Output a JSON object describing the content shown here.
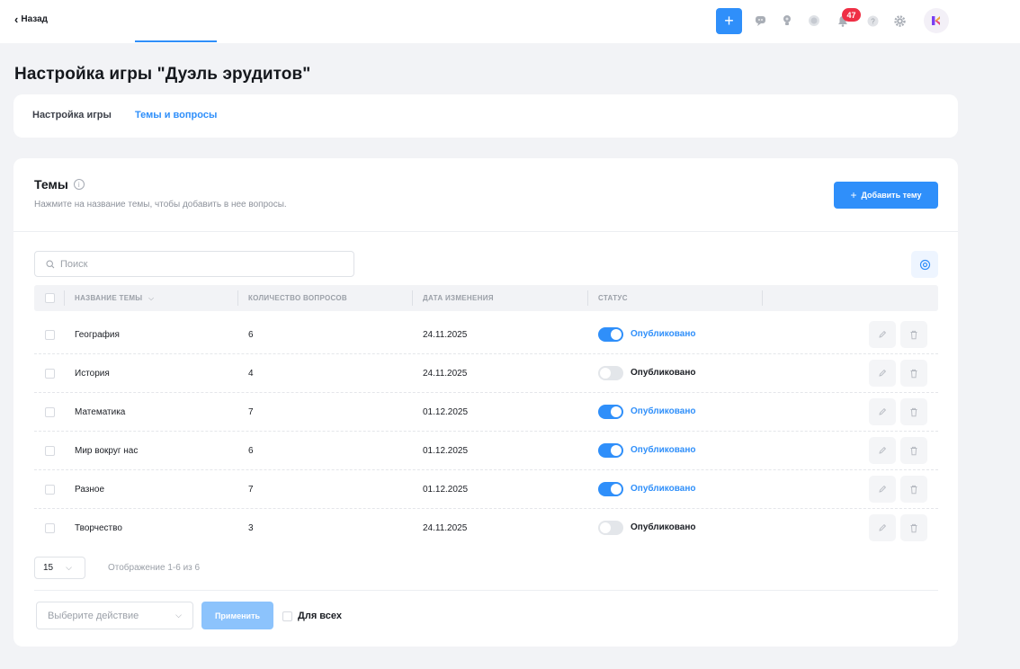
{
  "topbar": {
    "back_label": "Назад",
    "notifications_count": "47",
    "icons": [
      "plus-icon",
      "chat-icon",
      "lightbulb-icon",
      "search-icon",
      "bell-icon",
      "help-icon",
      "gear-icon",
      "logo-icon"
    ]
  },
  "page": {
    "title": "Настройка игры \"Дуэль эрудитов\""
  },
  "tabs": [
    {
      "label": "Настройка игры",
      "active": false
    },
    {
      "label": "Темы и вопросы",
      "active": true
    }
  ],
  "topics": {
    "title": "Темы",
    "subtitle": "Нажмите на название темы, чтобы добавить в нее вопросы.",
    "add_button": "Добавить тему",
    "search_placeholder": "Поиск",
    "columns": [
      "НАЗВАНИЕ ТЕМЫ",
      "КОЛИЧЕСТВО ВОПРОСОВ",
      "ДАТА ИЗМЕНЕНИЯ",
      "СТАТУС"
    ],
    "rows": [
      {
        "name": "География",
        "count": "6",
        "date": "24.11.2025",
        "status": "Опубликовано",
        "published": true
      },
      {
        "name": "История",
        "count": "4",
        "date": "24.11.2025",
        "status": "Опубликовано",
        "published": false
      },
      {
        "name": "Математика",
        "count": "7",
        "date": "01.12.2025",
        "status": "Опубликовано",
        "published": true
      },
      {
        "name": "Мир вокруг нас",
        "count": "6",
        "date": "01.12.2025",
        "status": "Опубликовано",
        "published": true
      },
      {
        "name": "Разное",
        "count": "7",
        "date": "01.12.2025",
        "status": "Опубликовано",
        "published": true
      },
      {
        "name": "Творчество",
        "count": "3",
        "date": "24.11.2025",
        "status": "Опубликовано",
        "published": false
      }
    ],
    "per_page": "15",
    "page_info": "Отображение 1-6 из 6",
    "action_placeholder": "Выберите действие",
    "apply_button": "Применить",
    "for_all_label": "Для всех"
  },
  "colors": {
    "accent": "#2f8ffa",
    "badge": "#ef2f45",
    "background": "#f2f3f6"
  }
}
